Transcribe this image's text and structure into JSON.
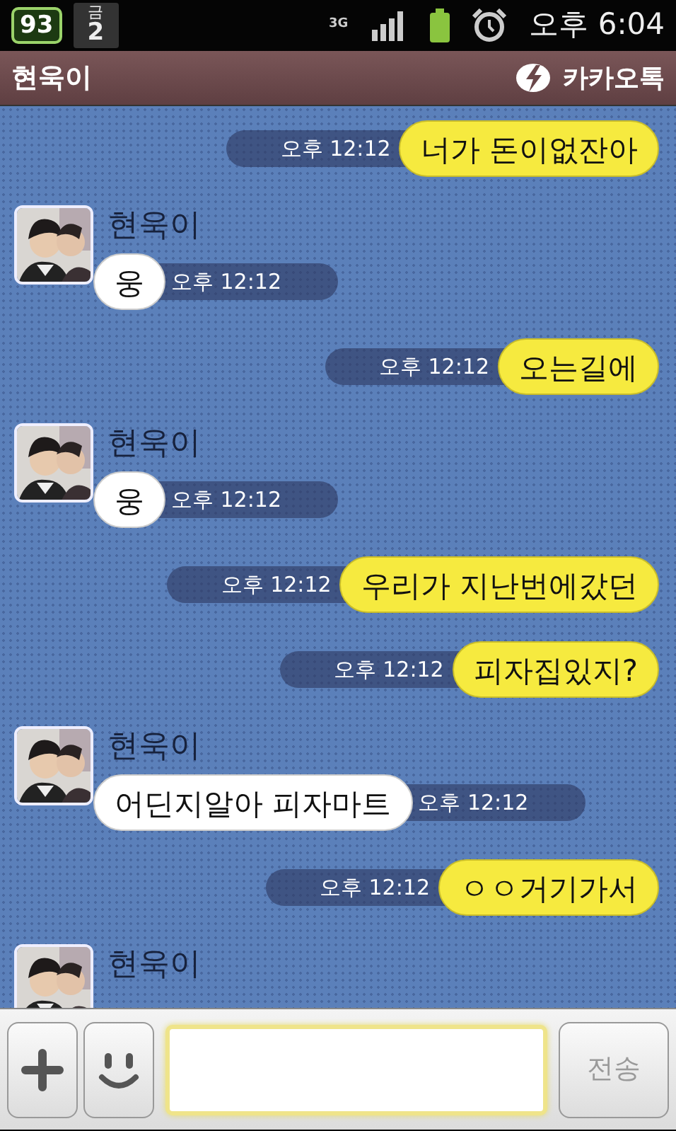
{
  "status_bar": {
    "battery_badge": "93",
    "calendar_day": "금",
    "calendar_date": "2",
    "network": "3G",
    "time": "오후 6:04"
  },
  "header": {
    "title": "현욱이",
    "app_name": "카카오톡"
  },
  "messages": [
    {
      "kind": "sent",
      "text": "너가 돈이없잔아",
      "time": "오후 12:12"
    },
    {
      "kind": "received",
      "name": "현욱이",
      "text": "웅",
      "time": "오후 12:12"
    },
    {
      "kind": "sent",
      "text": "오는길에",
      "time": "오후 12:12"
    },
    {
      "kind": "received",
      "name": "현욱이",
      "text": "웅",
      "time": "오후 12:12"
    },
    {
      "kind": "sent",
      "text": "우리가 지난번에갔던",
      "time": "오후 12:12"
    },
    {
      "kind": "sent",
      "text": "피자집있지?",
      "time": "오후 12:12"
    },
    {
      "kind": "received",
      "name": "현욱이",
      "text": "어딘지알아 피자마트",
      "time": "오후 12:12"
    },
    {
      "kind": "sent",
      "text": "ㅇㅇ거기가서",
      "time": "오후 12:12"
    },
    {
      "kind": "received",
      "name": "현욱이"
    }
  ],
  "composer": {
    "send_label": "전송",
    "send_disabled": true
  }
}
